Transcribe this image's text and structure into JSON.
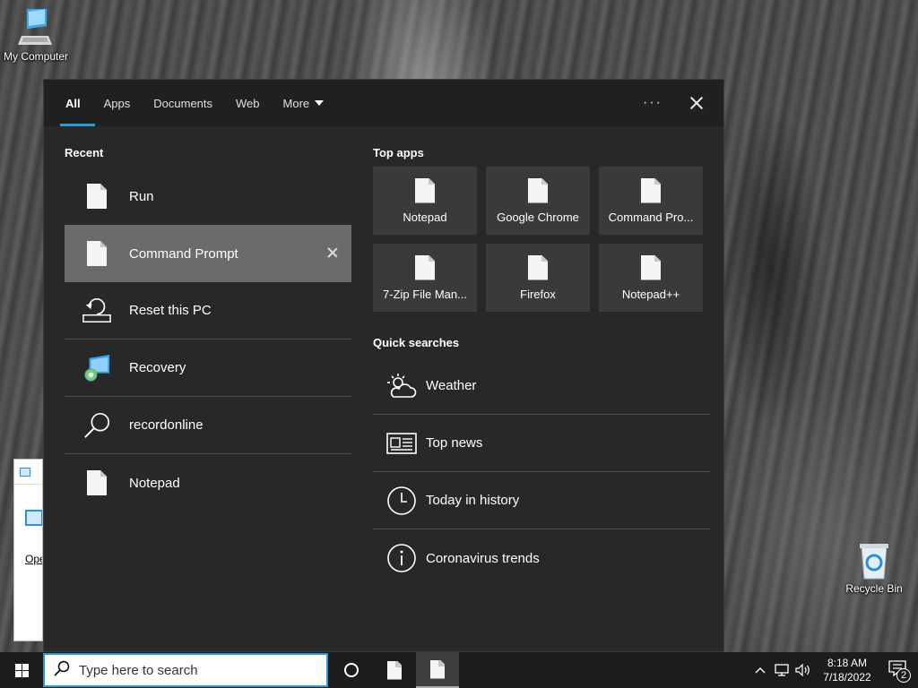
{
  "desktop": {
    "icons": [
      {
        "label": "My Computer",
        "icon": "computer-icon"
      },
      {
        "label": "Recycle Bin",
        "icon": "recycle-bin-icon"
      }
    ],
    "background_window": {
      "label": "Ope"
    }
  },
  "search_panel": {
    "tabs": [
      {
        "label": "All",
        "active": true
      },
      {
        "label": "Apps"
      },
      {
        "label": "Documents"
      },
      {
        "label": "Web"
      },
      {
        "label": "More"
      }
    ],
    "more_options_label": "···",
    "recent": {
      "title": "Recent",
      "items": [
        {
          "label": "Run",
          "icon": "document-icon"
        },
        {
          "label": "Command Prompt",
          "icon": "document-icon",
          "selected": true
        },
        {
          "label": "Reset this PC",
          "icon": "reset-pc-icon"
        },
        {
          "label": "Recovery",
          "icon": "recovery-icon"
        },
        {
          "label": "recordonline",
          "icon": "search-icon"
        },
        {
          "label": "Notepad",
          "icon": "document-icon"
        }
      ]
    },
    "top_apps": {
      "title": "Top apps",
      "apps": [
        {
          "label": "Notepad"
        },
        {
          "label": "Google Chrome"
        },
        {
          "label": "Command Pro..."
        },
        {
          "label": "7-Zip File Man..."
        },
        {
          "label": "Firefox"
        },
        {
          "label": "Notepad++"
        }
      ]
    },
    "quick_searches": {
      "title": "Quick searches",
      "items": [
        {
          "label": "Weather",
          "icon": "weather-icon"
        },
        {
          "label": "Top news",
          "icon": "news-icon"
        },
        {
          "label": "Today in history",
          "icon": "clock-icon"
        },
        {
          "label": "Coronavirus trends",
          "icon": "info-icon"
        }
      ]
    }
  },
  "taskbar": {
    "search_placeholder": "Type here to search",
    "clock_time": "8:18 AM",
    "clock_date": "7/18/2022",
    "notification_count": "2"
  },
  "colors": {
    "accent": "#2b9bd6",
    "panel_bg": "#282828",
    "selected_bg": "#6b6b6b"
  }
}
